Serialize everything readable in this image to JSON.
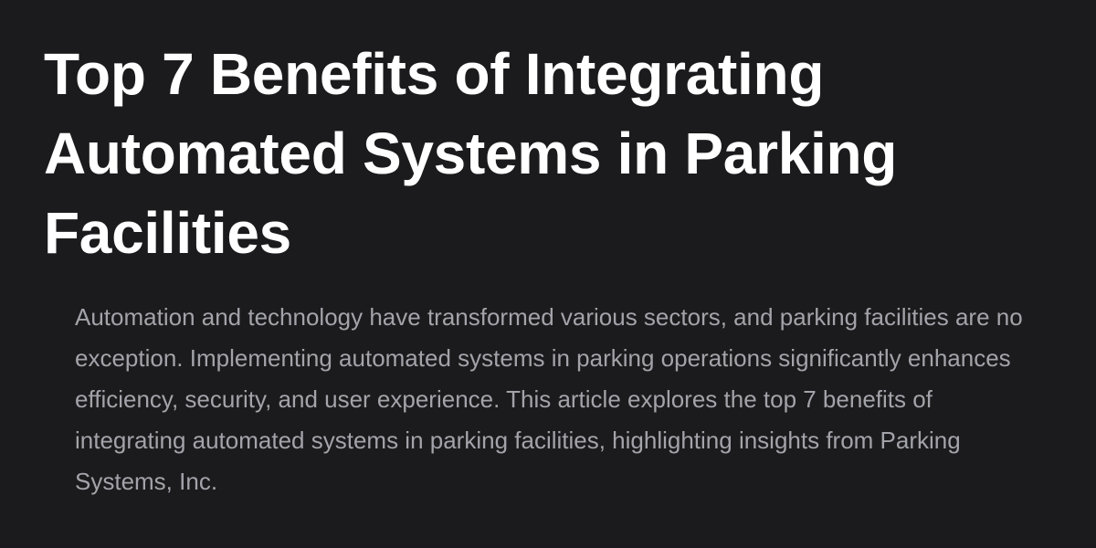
{
  "article": {
    "title": "Top 7 Benefits of Integrating Automated Systems in Parking Facilities",
    "excerpt": "Automation and technology have transformed various sectors, and parking facilities are no exception. Implementing automated systems in parking operations significantly enhances efficiency, security, and user experience. This article explores the top 7 benefits of integrating automated systems in parking facilities, highlighting insights from Parking Systems, Inc."
  },
  "colors": {
    "background": "#1b1b1d",
    "title_text": "#ffffff",
    "excerpt_text": "#a3a3aa"
  }
}
